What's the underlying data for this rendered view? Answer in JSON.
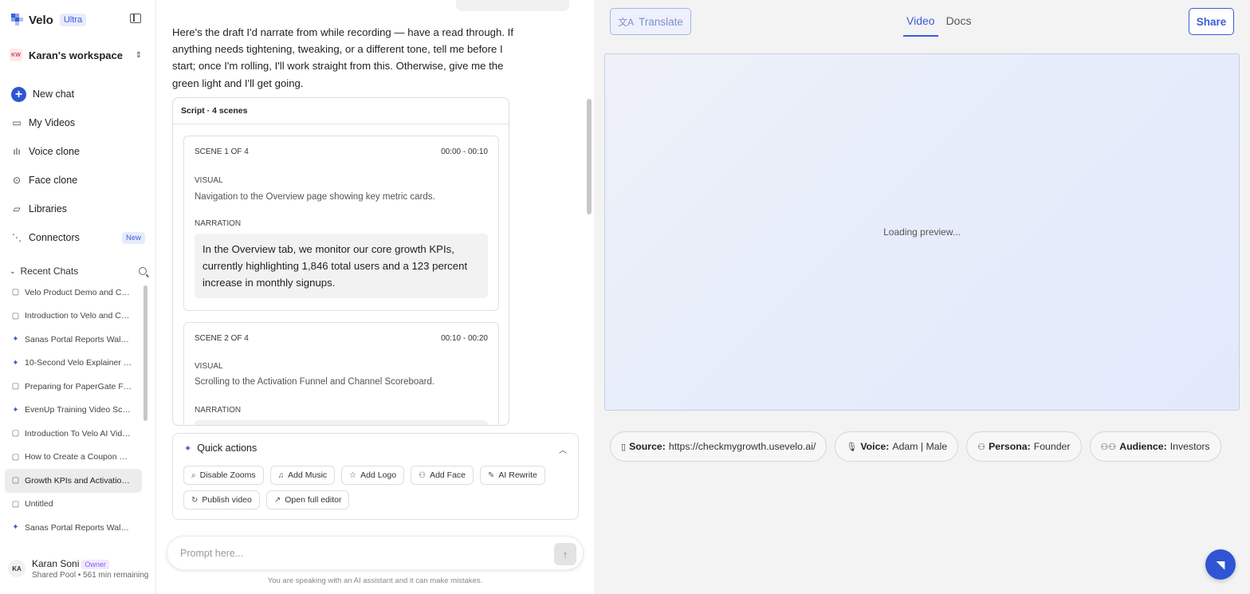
{
  "colors": {
    "accent": "#3b5bdb",
    "accent_fill": "#2f55d4",
    "panel_bg": "#f3f3f3"
  },
  "sidebar": {
    "brand": "Velo",
    "plan_badge": "Ultra",
    "workspace": {
      "initials": "KW",
      "name": "Karan's workspace"
    },
    "nav": [
      {
        "label": "New chat",
        "icon": "plus-icon"
      },
      {
        "label": "My Videos",
        "icon": "video-icon"
      },
      {
        "label": "Voice clone",
        "icon": "waveform-icon"
      },
      {
        "label": "Face clone",
        "icon": "face-scan-icon"
      },
      {
        "label": "Libraries",
        "icon": "folder-icon"
      },
      {
        "label": "Connectors",
        "icon": "connector-icon",
        "badge": "New"
      }
    ],
    "recent_title": "Recent Chats",
    "recent": [
      {
        "title": "Velo Product Demo and Caps...",
        "icon": "chat-icon"
      },
      {
        "title": "Introduction to Velo and Caps...",
        "icon": "chat-icon"
      },
      {
        "title": "Sanas Portal Reports Walkthr...",
        "icon": "sparkle-icon"
      },
      {
        "title": "10-Second Velo Explainer Vid...",
        "icon": "sparkle-icon"
      },
      {
        "title": "Preparing for PaperGate Full-...",
        "icon": "chat-icon"
      },
      {
        "title": "EvenUp Training Video Script",
        "icon": "sparkle-icon"
      },
      {
        "title": "Introduction To Velo AI Video ...",
        "icon": "chat-icon"
      },
      {
        "title": "How to Create a Coupon Cod...",
        "icon": "chat-icon"
      },
      {
        "title": "Growth KPIs and Activation F...",
        "icon": "chat-icon",
        "active": true
      },
      {
        "title": "Untitled",
        "icon": "chat-icon"
      },
      {
        "title": "Sanas Portal Reports Walkthr...",
        "icon": "sparkle-icon"
      }
    ],
    "user": {
      "initials": "KA",
      "name": "Karan Soni",
      "role": "Owner",
      "sub": "Shared Pool • 561 min remaining"
    }
  },
  "chat": {
    "intro": "Here's the draft I'd narrate from while recording — have a read through. If anything needs tightening, tweaking, or a different tone, tell me before I start; once I'm rolling, I'll work straight from this. Otherwise, give me the green light and I'll get going.",
    "script_title": "Script · 4 scenes",
    "scenes": [
      {
        "label": "SCENE 1 OF 4",
        "time": "00:00 - 00:10",
        "visual_label": "VISUAL",
        "visual": "Navigation to the Overview page showing key metric cards.",
        "narration_label": "NARRATION",
        "narration": "In the Overview tab, we monitor our core growth KPIs, currently highlighting 1,846 total users and a 123 percent increase in monthly signups."
      },
      {
        "label": "SCENE 2 OF 4",
        "time": "00:10 - 00:20",
        "visual_label": "VISUAL",
        "visual": "Scrolling to the Activation Funnel and Channel Scoreboard.",
        "narration_label": "NARRATION",
        "narration": ""
      }
    ],
    "quick_actions": {
      "title": "Quick actions",
      "items": [
        {
          "label": "Disable Zooms",
          "icon": "zoom-icon"
        },
        {
          "label": "Add Music",
          "icon": "music-icon"
        },
        {
          "label": "Add Logo",
          "icon": "star-icon"
        },
        {
          "label": "Add Face",
          "icon": "person-icon"
        },
        {
          "label": "AI Rewrite",
          "icon": "pencil-icon"
        },
        {
          "label": "Publish video",
          "icon": "refresh-icon"
        },
        {
          "label": "Open full editor",
          "icon": "external-link-icon"
        }
      ]
    },
    "prompt_placeholder": "Prompt here...",
    "disclaimer": "You are speaking with an AI assistant and it can make mistakes."
  },
  "preview": {
    "translate_label": "Translate",
    "tabs": [
      {
        "label": "Video",
        "active": true
      },
      {
        "label": "Docs",
        "active": false
      }
    ],
    "share_label": "Share",
    "loading": "Loading preview...",
    "meta": [
      {
        "key": "Source:",
        "value": "https://checkmygrowth.usevelo.ai/",
        "icon": "file-icon"
      },
      {
        "key": "Voice:",
        "value": "Adam | Male",
        "icon": "microphone-icon"
      },
      {
        "key": "Persona:",
        "value": "Founder",
        "icon": "person-icon"
      },
      {
        "key": "Audience:",
        "value": "Investors",
        "icon": "group-icon"
      }
    ]
  }
}
